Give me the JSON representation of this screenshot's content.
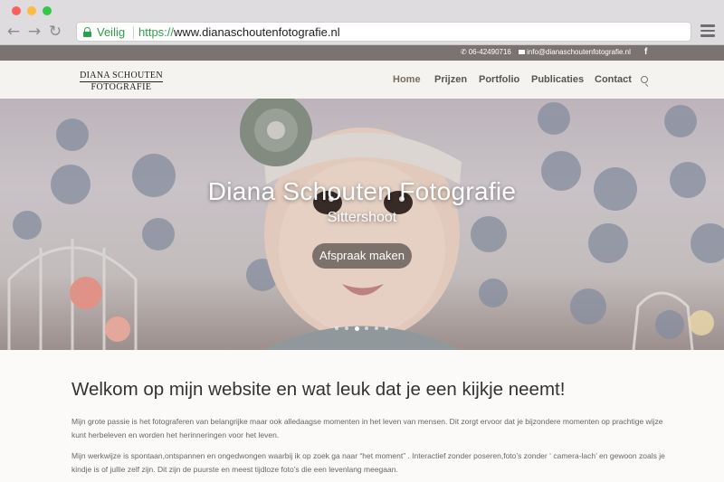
{
  "browser": {
    "secure_label": "Veilig",
    "url_scheme": "https://",
    "url_rest": "www.dianaschoutenfotografie.nl"
  },
  "topbar": {
    "phone": "06-42490716",
    "email": "info@dianaschoutenfotografie.nl",
    "social": "f"
  },
  "logo": {
    "line1": "DIANA SCHOUTEN",
    "line2": "FOTOGRAFIE"
  },
  "nav": {
    "home": "Home",
    "prijzen": "Prijzen",
    "portfolio": "Portfolio",
    "publicaties": "Publicaties",
    "contact": "Contact"
  },
  "hero": {
    "title": "Diana Schouten Fotografie",
    "subtitle": "Sittershoot",
    "button": "Afspraak maken",
    "slides_total": 6,
    "active_slide": 3
  },
  "content": {
    "heading": "Welkom op mijn website en wat leuk dat je een kijkje neemt!",
    "paragraph1": "Mijn grote passie is het fotograferen van belangrijke maar ook alledaagse momenten in het leven van mensen. Dit zorgt ervoor dat je bijzondere momenten op prachtige wijze kunt herbeleven en worden het herinneringen voor het leven.",
    "paragraph2": "Mijn werkwijze is spontaan,ontspannen en ongedwongen waarbij ik op zoek ga naar “het moment” . Interactief zonder poseren,foto’s zonder ‘ camera-lach’ en gewoon zoals je kindje is of jullie zelf zijn. Dit zijn de puurste en meest tijdloze foto’s die een levenlang meegaan."
  },
  "colors": {
    "secure_green": "#2aa148",
    "infobar": "#7b7371",
    "header_bg": "#f4f3f0",
    "button_bg": "#6e645f"
  }
}
